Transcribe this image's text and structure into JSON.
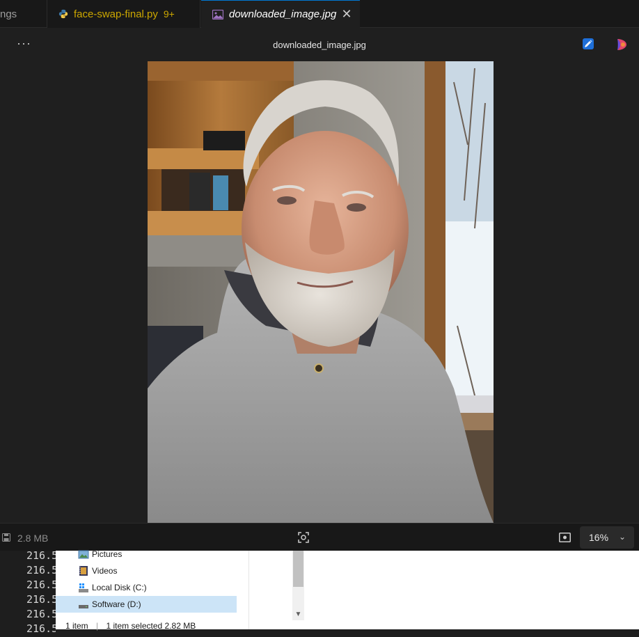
{
  "tabs": {
    "partial_label": "ngs",
    "python_tab": {
      "label": "face-swap-final.py",
      "badge": "9+"
    },
    "image_tab": {
      "label": "downloaded_image.jpg"
    }
  },
  "header": {
    "more_label": "···",
    "title": "downloaded_image.jpg"
  },
  "statusbar": {
    "file_size": "2.8 MB",
    "zoom": "16%",
    "chevron": "⌄"
  },
  "code_lines": [
    "216.5",
    "216.5",
    "216.5",
    "216.5",
    "216.5",
    "216.5"
  ],
  "explorer": {
    "items": [
      {
        "label": "Pictures",
        "icon": "pictures-folder-icon"
      },
      {
        "label": "Videos",
        "icon": "videos-folder-icon"
      },
      {
        "label": "Local Disk (C:)",
        "icon": "windows-drive-icon"
      },
      {
        "label": "Software (D:)",
        "icon": "drive-icon",
        "selected": true
      }
    ],
    "status_count": "1 item",
    "status_selected": "1 item selected  2.82 MB"
  },
  "colors": {
    "accent": "#0078d4",
    "python_tab_text": "#cca700",
    "selection": "#cce4f7"
  }
}
